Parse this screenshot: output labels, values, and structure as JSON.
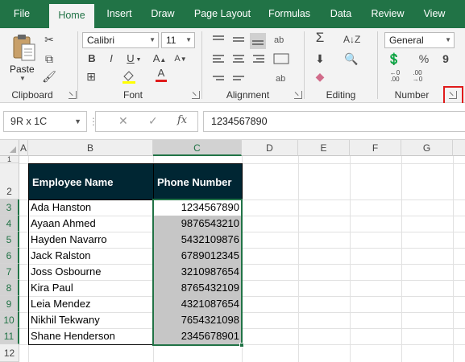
{
  "tabs": [
    "File",
    "Home",
    "Insert",
    "Draw",
    "Page Layout",
    "Formulas",
    "Data",
    "Review",
    "View"
  ],
  "active_tab": "Home",
  "ribbon": {
    "clipboard": {
      "paste_label": "Paste",
      "group_label": "Clipboard"
    },
    "font": {
      "font_name": "Calibri",
      "font_size": "11",
      "bold": "B",
      "italic": "I",
      "underline": "U",
      "group_label": "Font"
    },
    "alignment": {
      "group_label": "Alignment"
    },
    "editing": {
      "group_label": "Editing"
    },
    "number": {
      "format": "General",
      "percent": "%",
      "comma": "9",
      "group_label": "Number"
    }
  },
  "formula_bar": {
    "name_box": "9R x 1C",
    "fx": "fx",
    "value": "1234567890"
  },
  "columns": [
    "A",
    "B",
    "C",
    "D",
    "E",
    "F",
    "G"
  ],
  "rows": [
    "1",
    "2",
    "3",
    "4",
    "5",
    "6",
    "7",
    "8",
    "9",
    "10",
    "11",
    "12"
  ],
  "table": {
    "headers": [
      "Employee Name",
      "Phone Number"
    ],
    "rows": [
      [
        "Ada Hanston",
        "1234567890"
      ],
      [
        "Ayaan Ahmed",
        "9876543210"
      ],
      [
        "Hayden Navarro",
        "5432109876"
      ],
      [
        "Jack Ralston",
        "6789012345"
      ],
      [
        "Joss Osbourne",
        "3210987654"
      ],
      [
        "Kira Paul",
        "8765432109"
      ],
      [
        "Leia Mendez",
        "4321087654"
      ],
      [
        "Nikhil Tekwany",
        "7654321098"
      ],
      [
        "Shane Henderson",
        "2345678901"
      ]
    ]
  },
  "colors": {
    "accent": "#217346",
    "header_fill": "#002633",
    "selection_fill": "#c6c6c6",
    "highlight": "#e01b1b"
  }
}
